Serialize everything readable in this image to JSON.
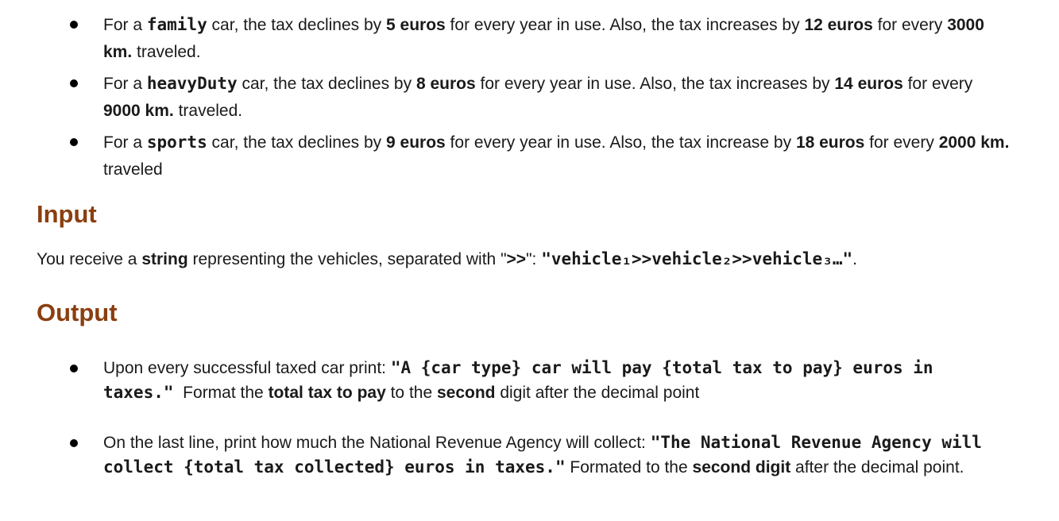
{
  "rules": [
    {
      "p1": "For a ",
      "type": "family",
      "p2": " car, the tax declines by ",
      "decline": "5 euros",
      "p3": " for every year in use. Also, the tax increases by ",
      "increase": "12 euros",
      "p4": " for every ",
      "distance": "3000 km.",
      "p5": " traveled."
    },
    {
      "p1": "For a ",
      "type": "heavyDuty",
      "p2": " car, the tax declines by ",
      "decline": "8 euros",
      "p3": " for every year in use. Also, the tax increases by ",
      "increase": "14 euros",
      "p4": " for every ",
      "distance": "9000 km.",
      "p5": " traveled."
    },
    {
      "p1": "For a ",
      "type": "sports",
      "p2": " car, the tax declines by ",
      "decline": "9 euros",
      "p3": " for every year in use. Also, the tax increase by ",
      "increase": "18 euros",
      "p4": " for every ",
      "distance": "2000 km.",
      "p5": " traveled"
    }
  ],
  "input": {
    "heading": "Input",
    "p1": "You receive a ",
    "b1": "string",
    "p2": " representing the vehicles, separated with \"",
    "b2": ">>",
    "p3": "\": ",
    "code": "\"vehicle₁>>vehicle₂>>vehicle₃…\"",
    "p4": "."
  },
  "output": {
    "heading": "Output",
    "item1": {
      "p1": "Upon every successful taxed car print: ",
      "code": "\"A {car type} car will pay {total tax to pay} euros in taxes.\"",
      "p2": "  Format the ",
      "b1": "total tax to pay",
      "p3": " to the ",
      "b2": "second",
      "p4": " digit after the decimal point"
    },
    "item2": {
      "p1": "On the last line, print how much the National Revenue Agency will collect: ",
      "code": "\"The National Revenue Agency will collect {total tax collected} euros in taxes.\"",
      "p2": " Formated to the ",
      "b1": "second digit",
      "p3": " after the decimal point."
    }
  }
}
